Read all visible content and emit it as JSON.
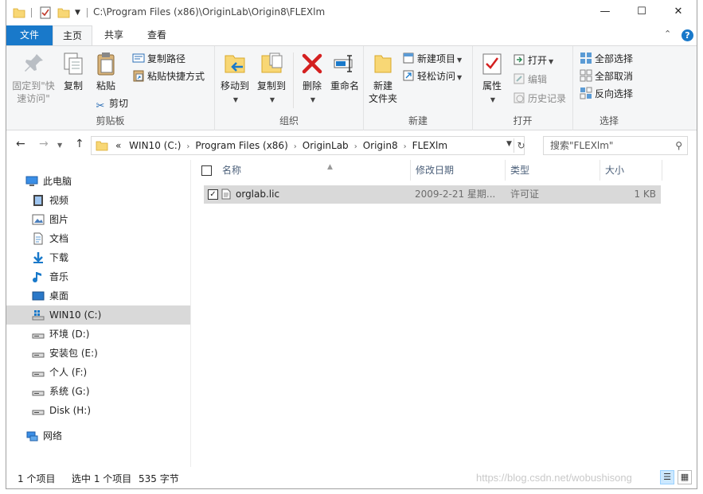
{
  "titlebar": {
    "path": "C:\\Program Files (x86)\\OriginLab\\Origin8\\FLEXlm",
    "minimize": "—",
    "maximize": "☐",
    "close": "✕"
  },
  "tabs": [
    {
      "label": "文件"
    },
    {
      "label": "主页"
    },
    {
      "label": "共享"
    },
    {
      "label": "查看"
    }
  ],
  "ribbon": {
    "clipboard": {
      "label": "剪贴板",
      "pin_line1": "固定到\"快",
      "pin_line2": "速访问\"",
      "copy": "复制",
      "paste": "粘贴",
      "copy_path": "复制路径",
      "paste_shortcut": "粘贴快捷方式",
      "cut": "剪切"
    },
    "organize": {
      "label": "组织",
      "move_to": "移动到",
      "copy_to": "复制到",
      "delete": "删除",
      "rename": "重命名"
    },
    "new": {
      "label": "新建",
      "new_folder_line1": "新建",
      "new_folder_line2": "文件夹",
      "new_item": "新建项目",
      "easy_access": "轻松访问"
    },
    "open": {
      "label": "打开",
      "properties": "属性",
      "open": "打开",
      "edit": "编辑",
      "history": "历史记录"
    },
    "select": {
      "label": "选择",
      "select_all": "全部选择",
      "select_none": "全部取消",
      "invert": "反向选择"
    }
  },
  "address": {
    "prefix": "«",
    "crumbs": [
      "WIN10 (C:)",
      "Program Files (x86)",
      "OriginLab",
      "Origin8",
      "FLEXlm"
    ],
    "separator": "›",
    "search_placeholder": "搜索\"FLEXlm\""
  },
  "navpane": {
    "items": [
      {
        "label": "此电脑",
        "icon": "pc-icon"
      },
      {
        "label": "视频",
        "icon": "video-icon"
      },
      {
        "label": "图片",
        "icon": "pictures-icon"
      },
      {
        "label": "文档",
        "icon": "documents-icon"
      },
      {
        "label": "下载",
        "icon": "download-icon"
      },
      {
        "label": "音乐",
        "icon": "music-icon"
      },
      {
        "label": "桌面",
        "icon": "desktop-icon"
      },
      {
        "label": "WIN10 (C:)",
        "icon": "windows-drive-icon"
      },
      {
        "label": "环境 (D:)",
        "icon": "drive-icon"
      },
      {
        "label": "安装包 (E:)",
        "icon": "drive-icon"
      },
      {
        "label": "个人 (F:)",
        "icon": "drive-icon"
      },
      {
        "label": "系统 (G:)",
        "icon": "drive-icon"
      },
      {
        "label": "Disk (H:)",
        "icon": "drive-icon"
      },
      {
        "label": "网络",
        "icon": "network-icon"
      }
    ]
  },
  "columns": [
    "名称",
    "修改日期",
    "类型",
    "大小"
  ],
  "files": [
    {
      "name": "orglab.lic",
      "modified": "2009-2-21 星期...",
      "type": "许可证",
      "size": "1 KB"
    }
  ],
  "status": {
    "count": "1 个项目",
    "selected": "选中 1 个项目",
    "size": "535 字节",
    "watermark": "https://blog.csdn.net/wobushisong"
  },
  "colors": {
    "accent": "#1979ca",
    "selection": "#d9d9d9",
    "ribbon_bg": "#f5f6f7"
  }
}
